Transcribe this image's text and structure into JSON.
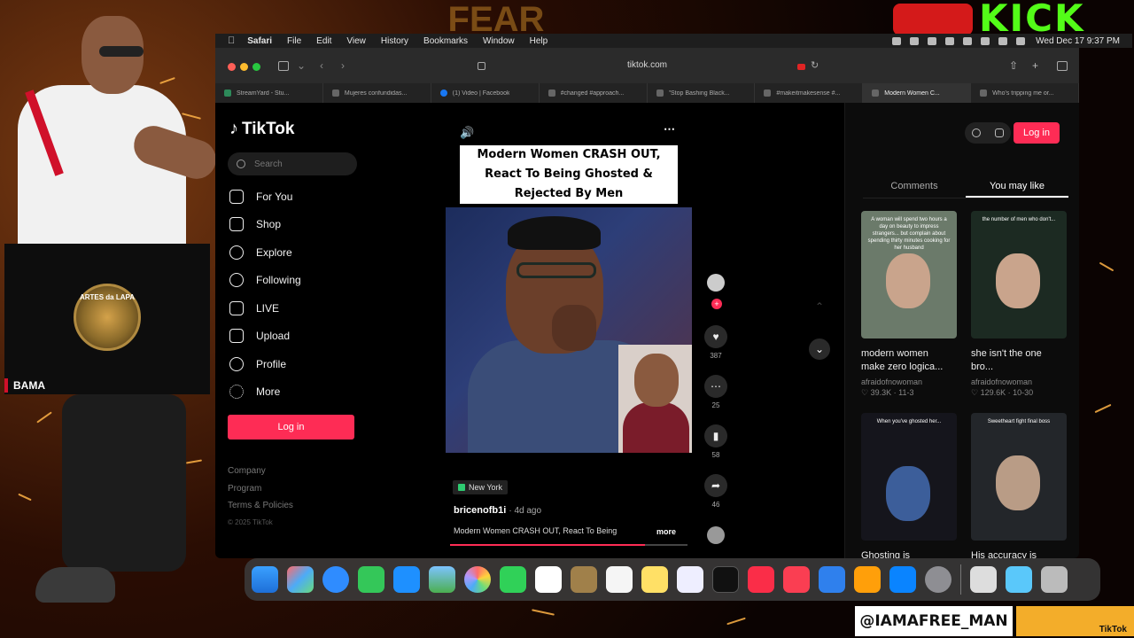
{
  "overlay": {
    "streamer_name": "BAMA",
    "cam_logo_text": "ARTES da LAPA",
    "social_handle": "@IAMAFREE_MAN",
    "tiktok_badge": "TikTok",
    "kick_text": "KICK",
    "banner_text": "FEAR"
  },
  "menubar": {
    "app": "Safari",
    "items": [
      "File",
      "Edit",
      "View",
      "History",
      "Bookmarks",
      "Window",
      "Help"
    ],
    "clock": "Wed Dec 17  9:37 PM"
  },
  "browser": {
    "url": "tiktok.com",
    "tabs": [
      {
        "label": "StreamYard - Stu..."
      },
      {
        "label": "Mujeres confundidas..."
      },
      {
        "label": "(1) Video | Facebook"
      },
      {
        "label": "#changed #approach..."
      },
      {
        "label": "\"Stop Bashing Black..."
      },
      {
        "label": "#makeitmakesense #..."
      },
      {
        "label": "Modern Women C...",
        "active": true
      },
      {
        "label": "Who's tripping me or..."
      }
    ]
  },
  "tiktok": {
    "logo": "TikTok",
    "search_placeholder": "Search",
    "nav": [
      {
        "label": "For You",
        "icon": "home-icon"
      },
      {
        "label": "Shop",
        "icon": "shop-icon"
      },
      {
        "label": "Explore",
        "icon": "compass-icon"
      },
      {
        "label": "Following",
        "icon": "following-icon"
      },
      {
        "label": "LIVE",
        "icon": "live-icon"
      },
      {
        "label": "Upload",
        "icon": "upload-icon"
      },
      {
        "label": "Profile",
        "icon": "profile-icon"
      },
      {
        "label": "More",
        "icon": "more-icon"
      }
    ],
    "login": "Log in",
    "footer": [
      "Company",
      "Program",
      "Terms & Policies"
    ],
    "copyright": "© 2025 TikTok"
  },
  "video": {
    "title": "Modern Women CRASH OUT, React To Being Ghosted & Rejected By Men",
    "location": "New York",
    "author": "bricenofb1i",
    "time": "· 4d ago",
    "caption": "Modern Women CRASH OUT, React To Being",
    "more": "more",
    "likes": "387",
    "comments": "25",
    "saves": "58",
    "shares": "46",
    "progress": 0.82
  },
  "right_panel": {
    "login": "Log in",
    "tabs": [
      "Comments",
      "You may like"
    ],
    "cards": [
      {
        "title": "modern women make zero logica...",
        "author": "afraidofnowoman",
        "likes": "39.3K",
        "date": "11-3",
        "thumb_text": "A woman will spend two hours a day on beauty to impress strangers... but complain about spending thirty minutes cooking for her husband"
      },
      {
        "title": "she isn't the one bro...",
        "author": "afraidofnowoman",
        "likes": "129.6K",
        "date": "10-30",
        "thumb_text": "the number of men who don't..."
      },
      {
        "title": "Ghosting is",
        "author": "",
        "likes": "",
        "date": "",
        "thumb_text": "When you've ghosted her..."
      },
      {
        "title": "His accuracy is",
        "author": "",
        "likes": "",
        "date": "",
        "thumb_text": "Sweetheart fight final boss"
      }
    ]
  },
  "dock": {
    "apps": [
      "finder",
      "launchpad",
      "safari",
      "messages",
      "mail",
      "maps",
      "photos",
      "facetime",
      "calendar",
      "notes-app",
      "reminders",
      "notes",
      "freeform",
      "tv",
      "music",
      "news",
      "keynote",
      "pages",
      "app-store",
      "settings",
      "preview",
      "downloads",
      "trash"
    ]
  }
}
